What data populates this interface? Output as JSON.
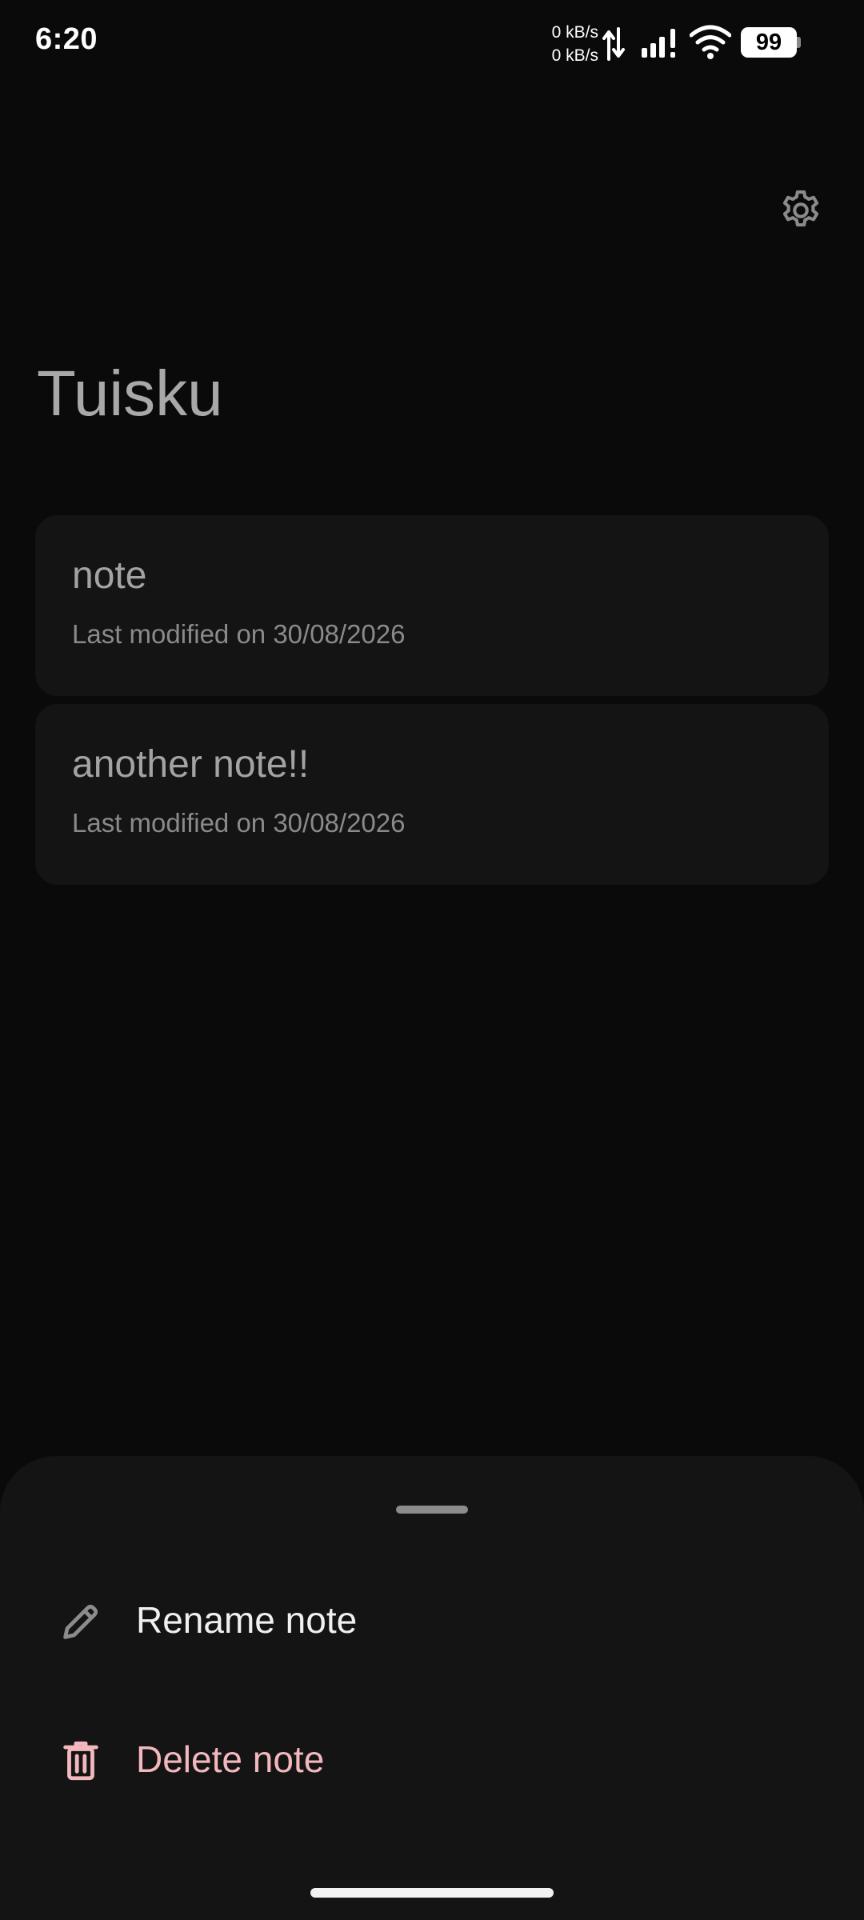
{
  "status_bar": {
    "time": "6:20",
    "net_up": "0 kB/s",
    "net_down": "0 kB/s",
    "battery_level": "99"
  },
  "header": {
    "title": "Tuisku",
    "settings_icon": "gear-icon"
  },
  "notes": [
    {
      "title": "note",
      "meta": "Last modified on 30/08/2026"
    },
    {
      "title": "another note!!",
      "meta": "Last modified on 30/08/2026"
    }
  ],
  "sheet": {
    "rename_label": "Rename note",
    "delete_label": "Delete note",
    "rename_icon": "pencil-icon",
    "delete_icon": "trash-icon"
  },
  "colors": {
    "background": "#0a0a0a",
    "card": "#141414",
    "sheet": "#141414",
    "delete_accent": "#f2b8bd",
    "title_text": "#a8a8a8"
  }
}
